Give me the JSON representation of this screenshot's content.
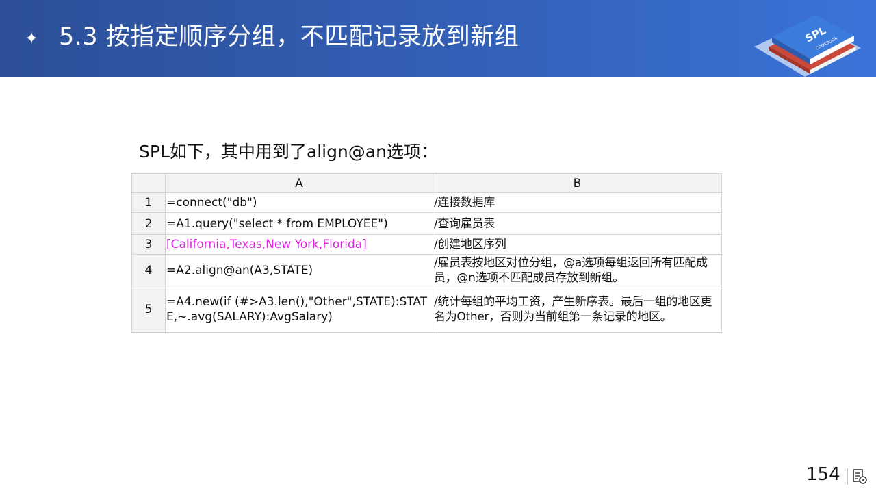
{
  "header": {
    "bullet": "✦",
    "title": "5.3  按指定顺序分组，不匹配记录放到新组"
  },
  "logo": {
    "text": "SPL",
    "subtext": "COOKBOOK"
  },
  "intro": "SPL如下，其中用到了align@an选项：",
  "table": {
    "columns": [
      "A",
      "B"
    ],
    "rows": [
      {
        "num": "1",
        "a": "=connect(\"db\")",
        "b": "/连接数据库"
      },
      {
        "num": "2",
        "a": "=A1.query(\"select * from EMPLOYEE\")",
        "b": "/查询雇员表"
      },
      {
        "num": "3",
        "a": "[California,Texas,New York,Florida]",
        "b": "/创建地区序列"
      },
      {
        "num": "4",
        "a": "=A2.align@an(A3,STATE)",
        "b": "/雇员表按地区对位分组，@a选项每组返回所有匹配成员，@n选项不匹配成员存放到新组。"
      },
      {
        "num": "5",
        "a": "=A4.new(if (#>A3.len(),\"Other\",STATE):STATE,~.avg(SALARY):AvgSalary)",
        "b": "/统计每组的平均工资，产生新序表。最后一组的地区更名为Other，否则为当前组第一条记录的地区。"
      }
    ]
  },
  "footer": {
    "page": "154"
  },
  "colors": {
    "header": "#3360b7",
    "constant": "#e020e0"
  }
}
